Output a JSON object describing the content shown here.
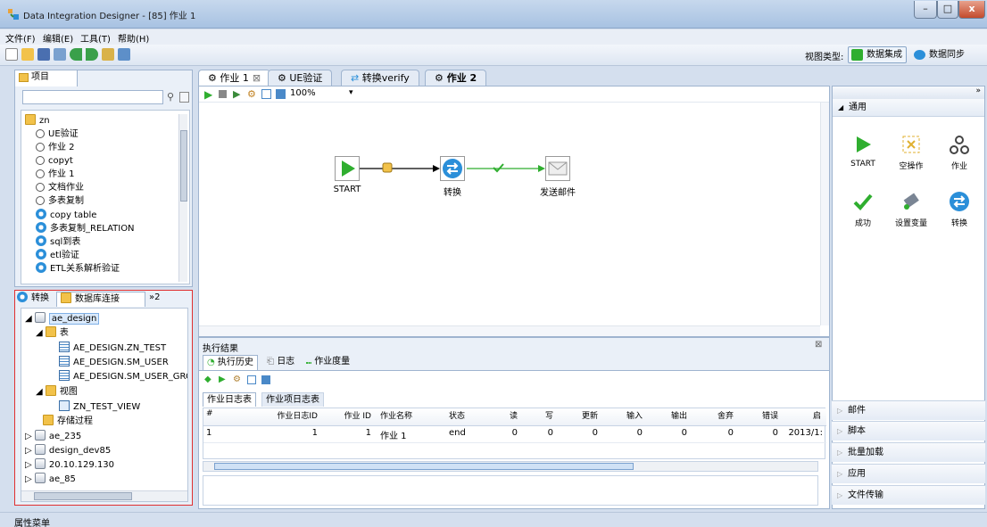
{
  "window": {
    "title": "Data Integration Designer - [85] 作业 1",
    "buttons": [
      "–",
      "□",
      "x"
    ]
  },
  "menu": [
    "文件(F)",
    "编辑(E)",
    "工具(T)",
    "帮助(H)"
  ],
  "toolbar": {
    "view_type_label": "视图类型:",
    "view_integration": "数据集成",
    "view_sync": "数据同步"
  },
  "project": {
    "tab": "项目",
    "search_placeholder": "",
    "root": "zn",
    "items": [
      {
        "label": "UE验证",
        "icon": "job-icon"
      },
      {
        "label": "作业 2",
        "icon": "job-icon"
      },
      {
        "label": "copyt",
        "icon": "job-icon"
      },
      {
        "label": "作业 1",
        "icon": "job-icon"
      },
      {
        "label": "文档作业",
        "icon": "job-icon"
      },
      {
        "label": "多表复制",
        "icon": "job-icon"
      },
      {
        "label": "copy table",
        "icon": "transform-icon"
      },
      {
        "label": "多表复制_RELATION",
        "icon": "transform-icon"
      },
      {
        "label": "sql到表",
        "icon": "transform-icon"
      },
      {
        "label": "etl验证",
        "icon": "transform-icon"
      },
      {
        "label": "ETL关系解析验证",
        "icon": "transform-icon"
      }
    ]
  },
  "db_panel": {
    "tabs": [
      "转换",
      "数据库连接",
      "»2"
    ],
    "tree": {
      "root": "ae_design",
      "tables_label": "表",
      "tables": [
        "AE_DESIGN.ZN_TEST",
        "AE_DESIGN.SM_USER",
        "AE_DESIGN.SM_USER_GRC"
      ],
      "views_label": "视图",
      "views": [
        "ZN_TEST_VIEW"
      ],
      "procs_label": "存储过程",
      "others": [
        "ae_235",
        "design_dev85",
        "20.10.129.130",
        "ae_85"
      ]
    }
  },
  "editor": {
    "tabs": [
      "作业 1",
      "UE验证",
      "转换verify",
      "作业 2"
    ],
    "zoom": "100%",
    "nodes": {
      "start": "START",
      "transform": "转换",
      "mail": "发送邮件"
    }
  },
  "results": {
    "title": "执行结果",
    "tabs": [
      "执行历史",
      "日志",
      "作业度量"
    ],
    "subtabs": [
      "作业日志表",
      "作业项日志表"
    ],
    "columns": [
      "#",
      "作业日志ID",
      "作业 ID",
      "作业名称",
      "状态",
      "读",
      "写",
      "更新",
      "输入",
      "输出",
      "舍弃",
      "错误",
      "启"
    ],
    "rows": [
      [
        "1",
        "1",
        "1",
        "作业 1",
        "end",
        "0",
        "0",
        "0",
        "0",
        "0",
        "0",
        "0",
        "2013/1:"
      ]
    ]
  },
  "palette": {
    "section": "通用",
    "items": [
      "START",
      "空操作",
      "作业",
      "成功",
      "设置变量",
      "转换"
    ],
    "accordions": [
      "邮件",
      "脚本",
      "批量加载",
      "应用",
      "文件传输"
    ]
  },
  "status": "属性菜单",
  "colors": {
    "accent": "#2b8fd9",
    "start_green": "#2fae2f",
    "highlight": "#e03030"
  }
}
